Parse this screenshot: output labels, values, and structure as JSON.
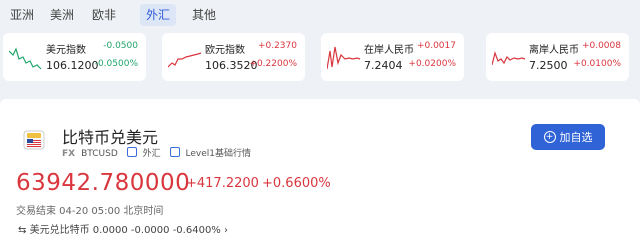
{
  "tabs": [
    {
      "label": "亚洲"
    },
    {
      "label": "美洲"
    },
    {
      "label": "欧非"
    },
    {
      "label": "外汇"
    },
    {
      "label": "其他"
    }
  ],
  "cards": [
    {
      "name": "美元指数",
      "price": "106.1200",
      "change": "-0.0500",
      "percent": "-0.0500%"
    },
    {
      "name": "欧元指数",
      "price": "106.3520",
      "change": "+0.2370",
      "percent": "+0.2200%"
    },
    {
      "name": "在岸人民币",
      "price": "7.2404",
      "change": "+0.0017",
      "percent": "+0.0200%"
    },
    {
      "name": "离岸人民币",
      "price": "7.2500",
      "change": "+0.0008",
      "percent": "+0.0100%"
    }
  ],
  "main": {
    "title": "比特币兑美元",
    "fx": "FX",
    "symbol": "BTCUSD",
    "category": "外汇",
    "level": "Level1基础行情",
    "price": "63942.780000",
    "change": "+417.2200",
    "percent": "+0.6600%",
    "status": "交易结束 04-20 05:00 北京时间",
    "conversion": "美元兑比特币 0.0000 -0.0000 -0.6400%",
    "add_button": "加自选"
  },
  "colors": {
    "up": "#d9363e",
    "down": "#1fa56b",
    "accent": "#2f63d6"
  }
}
